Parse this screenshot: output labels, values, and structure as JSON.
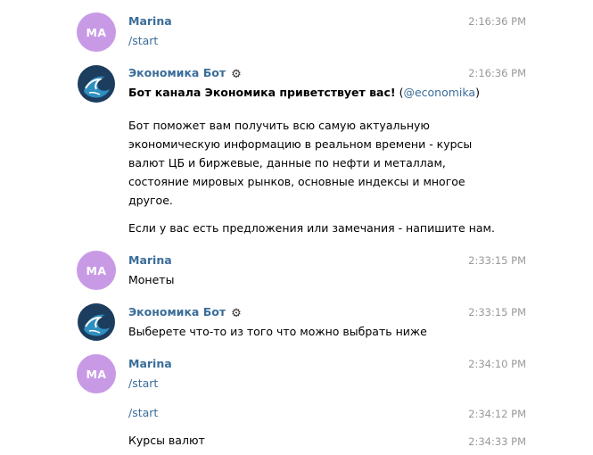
{
  "messages": {
    "m1": {
      "avatar_initials": "MA",
      "sender": "Marina",
      "time": "2:16:36 PM",
      "text": "/start"
    },
    "m2": {
      "sender": "Экономика Бот",
      "time": "2:16:36 PM",
      "greeting_bold": "Бот канала Экономика приветствует вас!",
      "paren_open": "(",
      "mention": "@economika",
      "paren_close": ")",
      "p1": [
        "Бот поможет вам получить всю самую актуальную",
        "экономическую информацию в реальном времени - курсы",
        "валют ЦБ и биржевые, данные по нефти и металлам,",
        "состояние мировых рынков, основные индексы и многое",
        "другое."
      ],
      "p2": "Если у вас есть предложения или замечания - напишите нам."
    },
    "m3": {
      "avatar_initials": "MA",
      "sender": "Marina",
      "time": "2:33:15 PM",
      "text": "Монеты"
    },
    "m4": {
      "sender": "Экономика Бот",
      "time": "2:33:15 PM",
      "text": "Выберете что-то из того что можно выбрать ниже"
    },
    "m5": {
      "avatar_initials": "MA",
      "sender": "Marina",
      "time": "2:34:10 PM",
      "text": "/start"
    },
    "m6": {
      "time": "2:34:12 PM",
      "text": "/start"
    },
    "m7": {
      "time": "2:34:33 PM",
      "text": "Курсы валют"
    }
  },
  "icons": {
    "bot_badge": "bot-badge-icon",
    "channel_logo": "economika-logo-icon"
  },
  "colors": {
    "avatar_bg": "#c89ae6",
    "name": "#3a6d99",
    "command": "#3a6d99",
    "time": "#999999",
    "logo_dark": "#1d3d5e",
    "logo_wave": "#2f8fc0"
  }
}
